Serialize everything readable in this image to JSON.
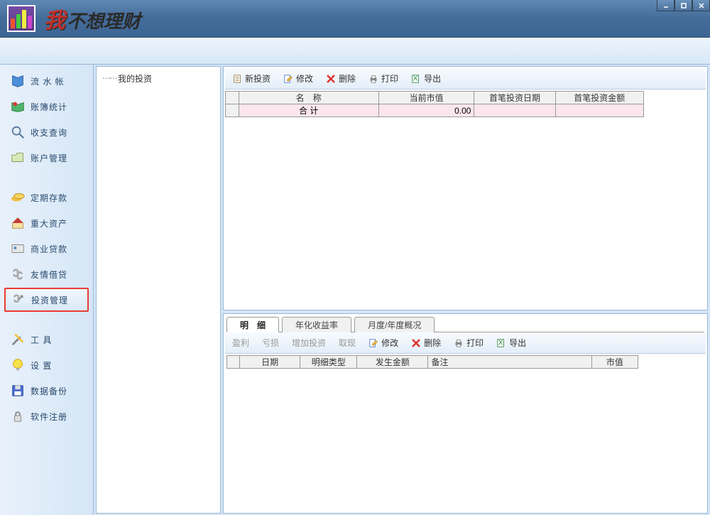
{
  "app": {
    "title_first_char": "我",
    "title_rest": "不想理财"
  },
  "window_controls": {
    "minimize": "minimize",
    "maximize": "maximize",
    "close": "close"
  },
  "sidebar": {
    "groups": [
      [
        {
          "label": "流 水 帐",
          "name": "sidebar-item-ledger",
          "icon": "book-blue-icon"
        },
        {
          "label": "账簿统计",
          "name": "sidebar-item-stats",
          "icon": "book-green-icon"
        },
        {
          "label": "收支查询",
          "name": "sidebar-item-query",
          "icon": "search-icon"
        },
        {
          "label": "账户管理",
          "name": "sidebar-item-account",
          "icon": "folder-icon"
        }
      ],
      [
        {
          "label": "定期存款",
          "name": "sidebar-item-deposit",
          "icon": "money-icon"
        },
        {
          "label": "重大资产",
          "name": "sidebar-item-asset",
          "icon": "house-icon"
        },
        {
          "label": "商业贷款",
          "name": "sidebar-item-loan",
          "icon": "card-icon"
        },
        {
          "label": "友情借贷",
          "name": "sidebar-item-friend-loan",
          "icon": "link-icon"
        },
        {
          "label": "投资管理",
          "name": "sidebar-item-investment",
          "icon": "invest-icon",
          "active": true
        }
      ],
      [
        {
          "label": "工    具",
          "name": "sidebar-item-tools",
          "icon": "tools-icon"
        },
        {
          "label": "设    置",
          "name": "sidebar-item-settings",
          "icon": "bulb-icon"
        },
        {
          "label": "数据备份",
          "name": "sidebar-item-backup",
          "icon": "disk-icon"
        },
        {
          "label": "软件注册",
          "name": "sidebar-item-register",
          "icon": "lock-icon"
        }
      ]
    ]
  },
  "tree": {
    "root": "我的投资"
  },
  "top_toolbar": {
    "new": "新投资",
    "edit": "修改",
    "delete": "删除",
    "print": "打印",
    "export": "导出"
  },
  "top_table": {
    "headers": {
      "name": "名　称",
      "market_value": "当前市值",
      "first_date": "首笔投资日期",
      "first_amount": "首笔投资金额"
    },
    "total_row": {
      "label": "合 计",
      "market_value": "0.00",
      "first_date": "",
      "first_amount": ""
    }
  },
  "tabs": {
    "detail": "明　细",
    "annual": "年化收益率",
    "period": "月度/年度概况"
  },
  "bottom_toolbar": {
    "profit": "盈利",
    "loss": "亏损",
    "add": "增加投资",
    "withdraw": "取现",
    "edit": "修改",
    "delete": "删除",
    "print": "打印",
    "export": "导出"
  },
  "detail_table": {
    "headers": {
      "date": "日期",
      "type": "明细类型",
      "amount": "发生金额",
      "remark": "备注",
      "value": "市值"
    }
  }
}
